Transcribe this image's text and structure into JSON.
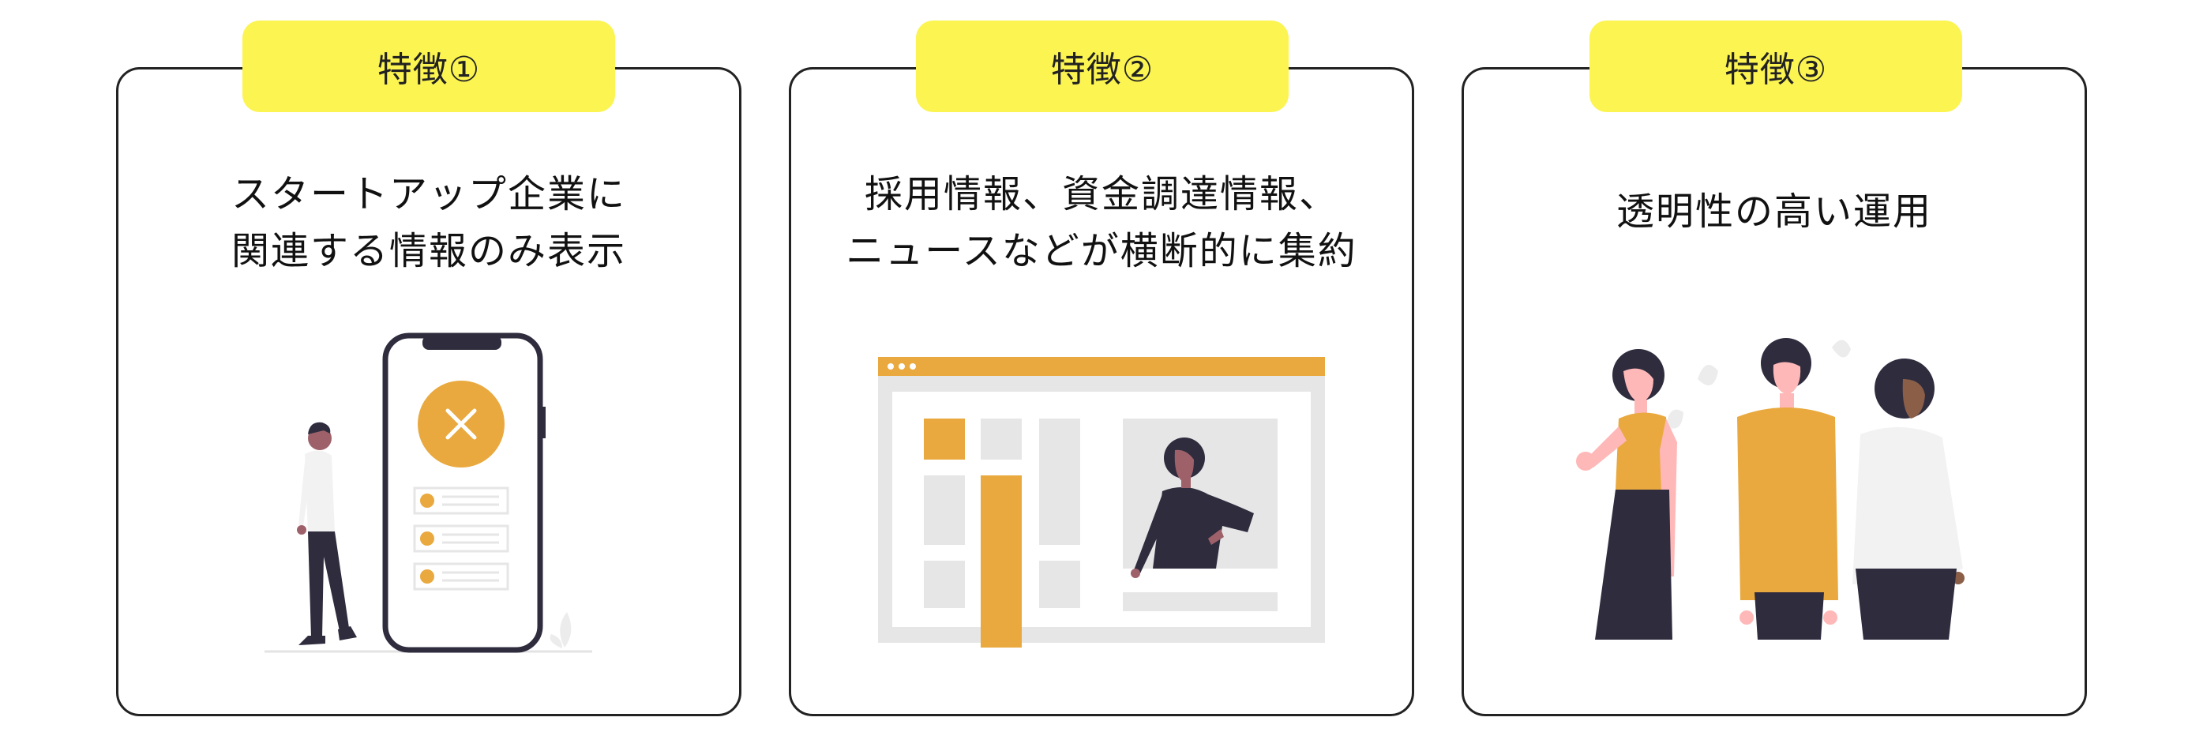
{
  "features": [
    {
      "tag": "特徴①",
      "lines": [
        "スタートアップ企業に",
        "関連する情報のみ表示"
      ]
    },
    {
      "tag": "特徴②",
      "lines": [
        "採用情報、資金調達情報、",
        "ニュースなどが横断的に集約"
      ]
    },
    {
      "tag": "特徴③",
      "lines": [
        "透明性の高い運用"
      ]
    }
  ],
  "colors": {
    "tag_background": "#fbf451",
    "accent": "#e9a93f",
    "dark": "#2f2c3e",
    "light_gray": "#e6e6e6"
  },
  "icons": {
    "card1": "phone-with-person-illustration",
    "card2": "browser-window-illustration",
    "card3": "three-people-illustration"
  }
}
